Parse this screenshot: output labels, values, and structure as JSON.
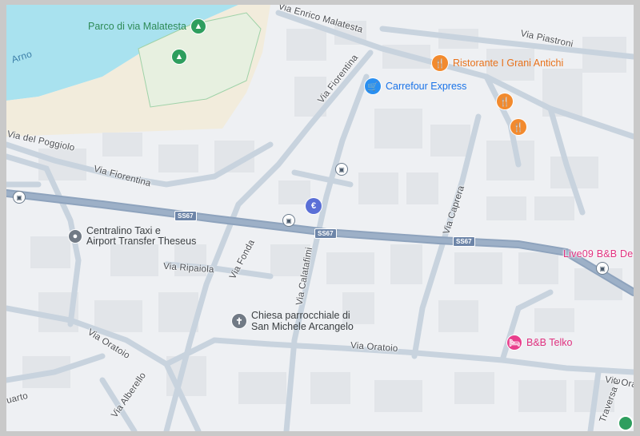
{
  "map": {
    "colors": {
      "background": "#eef0f3",
      "water": "#a9e2ef",
      "beige": "#f2ecdc",
      "park": "#e7f0e0",
      "building": "#e3e6ea",
      "road": "#c6d2dd",
      "highway": "#8ea3bd",
      "poi_restaurant": "#f28a2e",
      "poi_shop": "#2a8ff0",
      "poi_bank": "#5a6fd6",
      "poi_hotel": "#e83e8c",
      "poi_generic": "#717a85",
      "poi_park": "#2e9e5e"
    },
    "water_label": "Arno",
    "streets": {
      "via_enrico_malatesta": "Via Enrico Malatesta",
      "via_piastroni": "Via Piastroni",
      "via_fiorentina_upper": "Via Fiorentina",
      "via_del_poggiolo": "Via del Poggiolo",
      "via_fiorentina_lower": "Via Fiorentina",
      "via_capera": "Via Caprera",
      "via_ripaiola": "Via Ripaiola",
      "via_fonda": "Via Fonda",
      "via_calatafimi": "Via Calatafimi",
      "via_oratoio_left": "Via Oratoio",
      "via_oratoio_center": "Via Oratoio",
      "via_oratoio_right": "Via Ora",
      "uarto": "uarto",
      "via_alberello": "Via Alberello",
      "traversa": "Traversa C"
    },
    "highway_shields": [
      "SS67",
      "SS67",
      "SS67"
    ],
    "pois": {
      "park": "Parco di via Malatesta",
      "restaurant": "Ristorante I Grani Antichi",
      "supermarket": "Carrefour Express",
      "taxi_line1": "Centralino Taxi e",
      "taxi_line2": "Airport Transfer Theseus",
      "church_line1": "Chiesa parrocchiale di",
      "church_line2": "San Michele Arcangelo",
      "bnb_right": "Live09 B&B De",
      "bnb_telko": "B&B Telko"
    },
    "icons": {
      "restaurant": "🍴",
      "bank": "€",
      "cart": "🛒",
      "bed": "🛏",
      "tree": "▲",
      "cross": "✝",
      "bus": "▣"
    }
  }
}
